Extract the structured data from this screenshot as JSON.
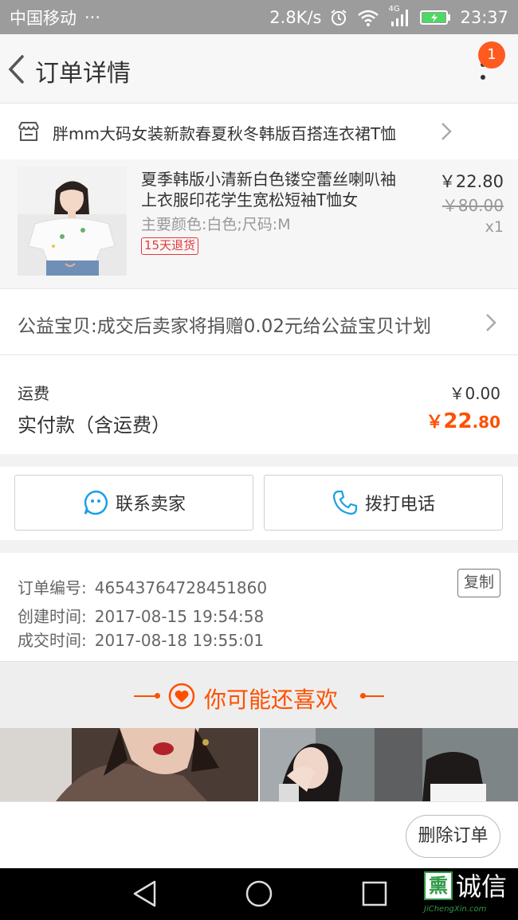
{
  "status_bar": {
    "carrier": "中国移动",
    "dots": "···",
    "speed": "2.8K/s",
    "network": "4G",
    "time": "23:37"
  },
  "header": {
    "title": "订单详情",
    "badge_count": "1"
  },
  "shop": {
    "name": "胖mm大码女装新款春夏秋冬韩版百搭连衣裙T恤"
  },
  "item": {
    "title": "夏季韩版小清新白色镂空蕾丝喇叭袖上衣服印花学生宽松短袖T恤女",
    "spec": "主要颜色:白色;尺码:M",
    "tag": "15天退货",
    "price": "￥22.80",
    "original_price": "￥80.00",
    "quantity": "x1"
  },
  "charity": {
    "text": "公益宝贝:成交后卖家将捐赠0.02元给公益宝贝计划"
  },
  "fees": {
    "shipping_label": "运费",
    "shipping_value": "￥0.00",
    "paid_label": "实付款（含运费）",
    "paid_currency": "￥",
    "paid_int": "22",
    "paid_dec": ".80"
  },
  "actions": {
    "contact_label": "联系卖家",
    "call_label": "拨打电话"
  },
  "order_info": {
    "number_label": "订单编号:",
    "number_value": "46543764728451860",
    "copy_label": "复制",
    "created_label": "创建时间:",
    "created_value": "2017-08-15 19:54:58",
    "completed_label": "成交时间:",
    "completed_value": "2017-08-18 19:55:01"
  },
  "recommend": {
    "title": "你可能还喜欢"
  },
  "bottom": {
    "delete_label": "删除订单"
  },
  "watermark": {
    "box_char": "熏",
    "text": "诚信",
    "url": "JiChengXin.com"
  },
  "colors": {
    "accent": "#ff5000",
    "badge": "#ff5a1f",
    "tag_red": "#e4393c",
    "icon_blue": "#1aa0e6"
  }
}
